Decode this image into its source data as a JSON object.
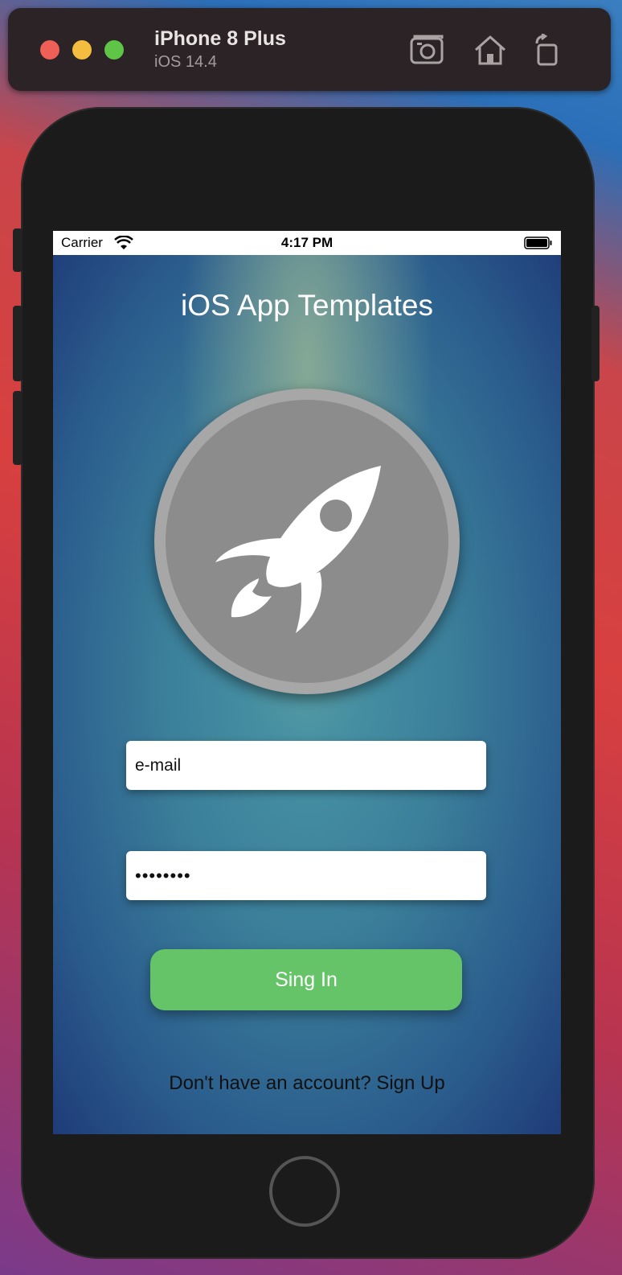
{
  "simulator": {
    "device_name": "iPhone 8 Plus",
    "os_version": "iOS 14.4",
    "icons": [
      "screenshot-icon",
      "home-icon",
      "rotate-icon"
    ]
  },
  "status_bar": {
    "carrier": "Carrier",
    "time": "4:17 PM"
  },
  "app": {
    "title": "iOS App Templates",
    "logo_icon": "rocket-icon",
    "email_placeholder": "e-mail",
    "password_value": "••••••••",
    "signin_label": "Sing In",
    "signup_text": "Don't have an account? Sign Up"
  },
  "colors": {
    "signin_button": "#65c468",
    "logo_ring": "#a7a7a7",
    "logo_fill": "#8c8c8c"
  }
}
